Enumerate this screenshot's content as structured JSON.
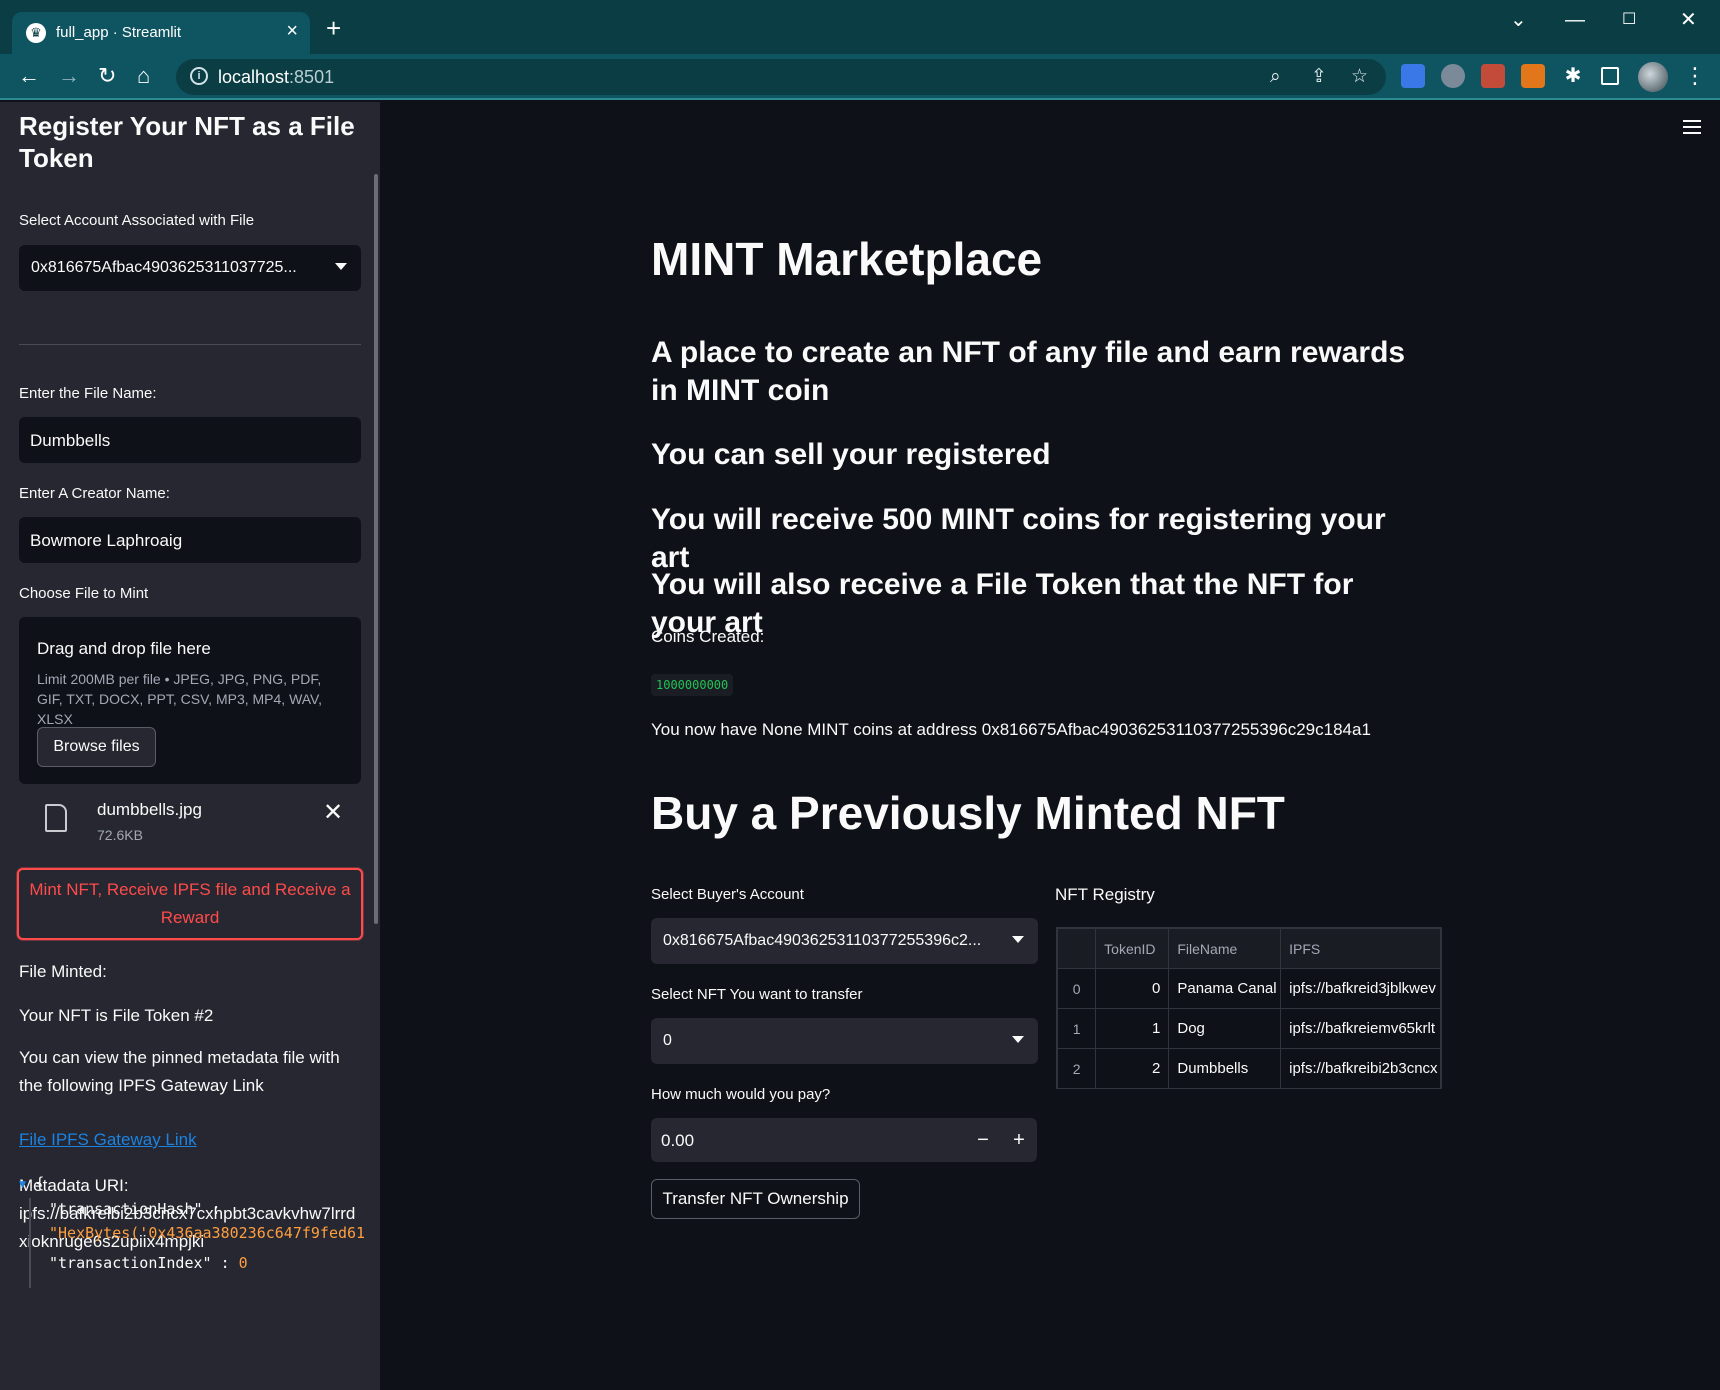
{
  "browser": {
    "tab_title": "full_app · Streamlit",
    "url_host": "localhost",
    "url_port": ":8501"
  },
  "sidebar": {
    "title": "Register Your NFT as a File Token",
    "account_label": "Select Account Associated with File",
    "account_value": "0x816675Afbac4903625311037725...",
    "file_name_label": "Enter the File Name:",
    "file_name_value": "Dumbbells",
    "creator_label": "Enter A Creator Name:",
    "creator_value": "Bowmore Laphroaig",
    "upload_label": "Choose File to Mint",
    "upload_title": "Drag and drop file here",
    "upload_limit": "Limit 200MB per file • JPEG, JPG, PNG, PDF, GIF, TXT, DOCX, PPT, CSV, MP3, MP4, WAV, XLSX",
    "browse_label": "Browse files",
    "uploaded_file_name": "dumbbells.jpg",
    "uploaded_file_size": "72.6KB",
    "mint_button": "Mint NFT, Receive IPFS file and Receive a Reward",
    "file_minted": "File Minted:",
    "token_text": "Your NFT is File Token #2",
    "view_text": "You can view the pinned metadata file with the following IPFS Gateway Link",
    "gateway_link": "File IPFS Gateway Link",
    "metadata_label": "Metadata URI:",
    "metadata_uri": "ipfs://bafkreibi2b3cncx7cxhpbt3cavkvhw7lrrdxioknruge6s2upiix4mpjki",
    "json_open": "{",
    "json_key_1": "\"transactionHash\"",
    "json_colon": ":",
    "json_val_1": "\"HexBytes('0x436aa380236c647f9fed61",
    "json_key_2": "\"transactionIndex\"",
    "json_val_2": "0"
  },
  "main": {
    "title": "MINT Marketplace",
    "subtitle_1": "A place to create an NFT of any file and earn rewards in MINT coin",
    "subtitle_2": "You can sell your registered",
    "subtitle_3": "You will receive 500 MINT coins for registering your art",
    "subtitle_4": "You will also receive a File Token that the NFT for your art",
    "coins_label": "Coins Created:",
    "coins_value": "1000000000",
    "balance_text": "You now have None MINT coins at address 0x816675Afbac49036253110377255396c29c184a1",
    "buy_title": "Buy a Previously Minted NFT",
    "buyer_label": "Select Buyer's Account",
    "buyer_value": "0x816675Afbac49036253110377255396c2...",
    "nft_label": "Select NFT You want to transfer",
    "nft_value": "0",
    "pay_label": "How much would you pay?",
    "pay_value": "0.00",
    "transfer_button": "Transfer NFT Ownership",
    "registry_label": "NFT Registry",
    "registry": {
      "columns": [
        "",
        "TokenID",
        "FileName",
        "IPFS"
      ],
      "rows": [
        {
          "index": "0",
          "token_id": "0",
          "file_name": "Panama Canal",
          "ipfs": "ipfs://bafkreid3jblkwev"
        },
        {
          "index": "1",
          "token_id": "1",
          "file_name": "Dog",
          "ipfs": "ipfs://bafkreiemv65krlt"
        },
        {
          "index": "2",
          "token_id": "2",
          "file_name": "Dumbbells",
          "ipfs": "ipfs://bafkreibi2b3cncx"
        }
      ]
    }
  },
  "colors": {
    "primary": "#ff4b4b",
    "link": "#1c83e1",
    "code_green": "#21c354",
    "background": "#0e1117",
    "sidebar_bg": "#262730"
  }
}
